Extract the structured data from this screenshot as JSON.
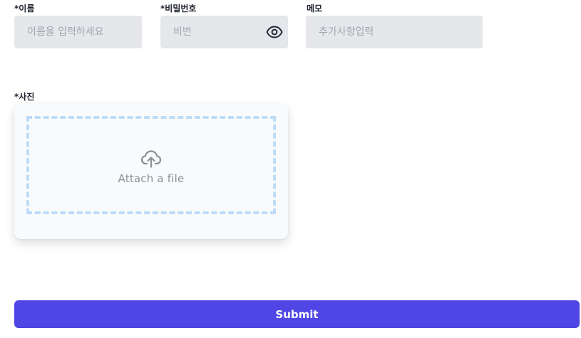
{
  "form": {
    "name": {
      "label": "*이름",
      "placeholder": "이름을 입력하세요",
      "value": ""
    },
    "password": {
      "label": "*비밀번호",
      "placeholder": "비번",
      "value": "",
      "toggle_icon": "eye-icon"
    },
    "memo": {
      "label": "메모",
      "placeholder": "추가사항입력",
      "value": ""
    },
    "photo": {
      "label": "*사진",
      "dropzone_text": "Attach a file",
      "icon": "cloud-upload-icon",
      "border_color": "#bfdbf7"
    },
    "submit_label": "Submit"
  },
  "colors": {
    "accent": "#4f46e5",
    "input_bg": "#e5e7eb",
    "placeholder": "#a1a5ad"
  }
}
